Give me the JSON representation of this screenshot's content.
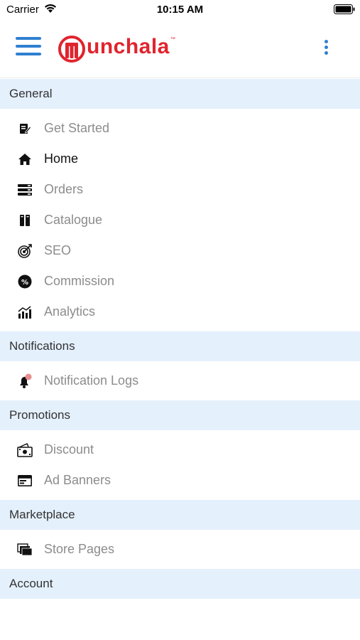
{
  "status_bar": {
    "carrier": "Carrier",
    "time": "10:15 AM"
  },
  "header": {
    "logo_text": "unchala",
    "logo_tm": "™",
    "brand_color": "#e0242e",
    "accent_color": "#2f80d1"
  },
  "sections": [
    {
      "title": "General",
      "items": [
        {
          "label": "Get Started",
          "icon": "edit-document-icon"
        },
        {
          "label": "Home",
          "icon": "home-icon",
          "active": true
        },
        {
          "label": "Orders",
          "icon": "orders-icon"
        },
        {
          "label": "Catalogue",
          "icon": "catalogue-icon"
        },
        {
          "label": "SEO",
          "icon": "target-icon"
        },
        {
          "label": "Commission",
          "icon": "percent-icon"
        },
        {
          "label": "Analytics",
          "icon": "analytics-icon"
        }
      ]
    },
    {
      "title": "Notifications",
      "items": [
        {
          "label": "Notification Logs",
          "icon": "bell-icon"
        }
      ]
    },
    {
      "title": "Promotions",
      "items": [
        {
          "label": "Discount",
          "icon": "money-icon"
        },
        {
          "label": "Ad Banners",
          "icon": "banner-icon"
        }
      ]
    },
    {
      "title": "Marketplace",
      "items": [
        {
          "label": "Store Pages",
          "icon": "pages-icon"
        }
      ]
    },
    {
      "title": "Account",
      "items": []
    }
  ]
}
